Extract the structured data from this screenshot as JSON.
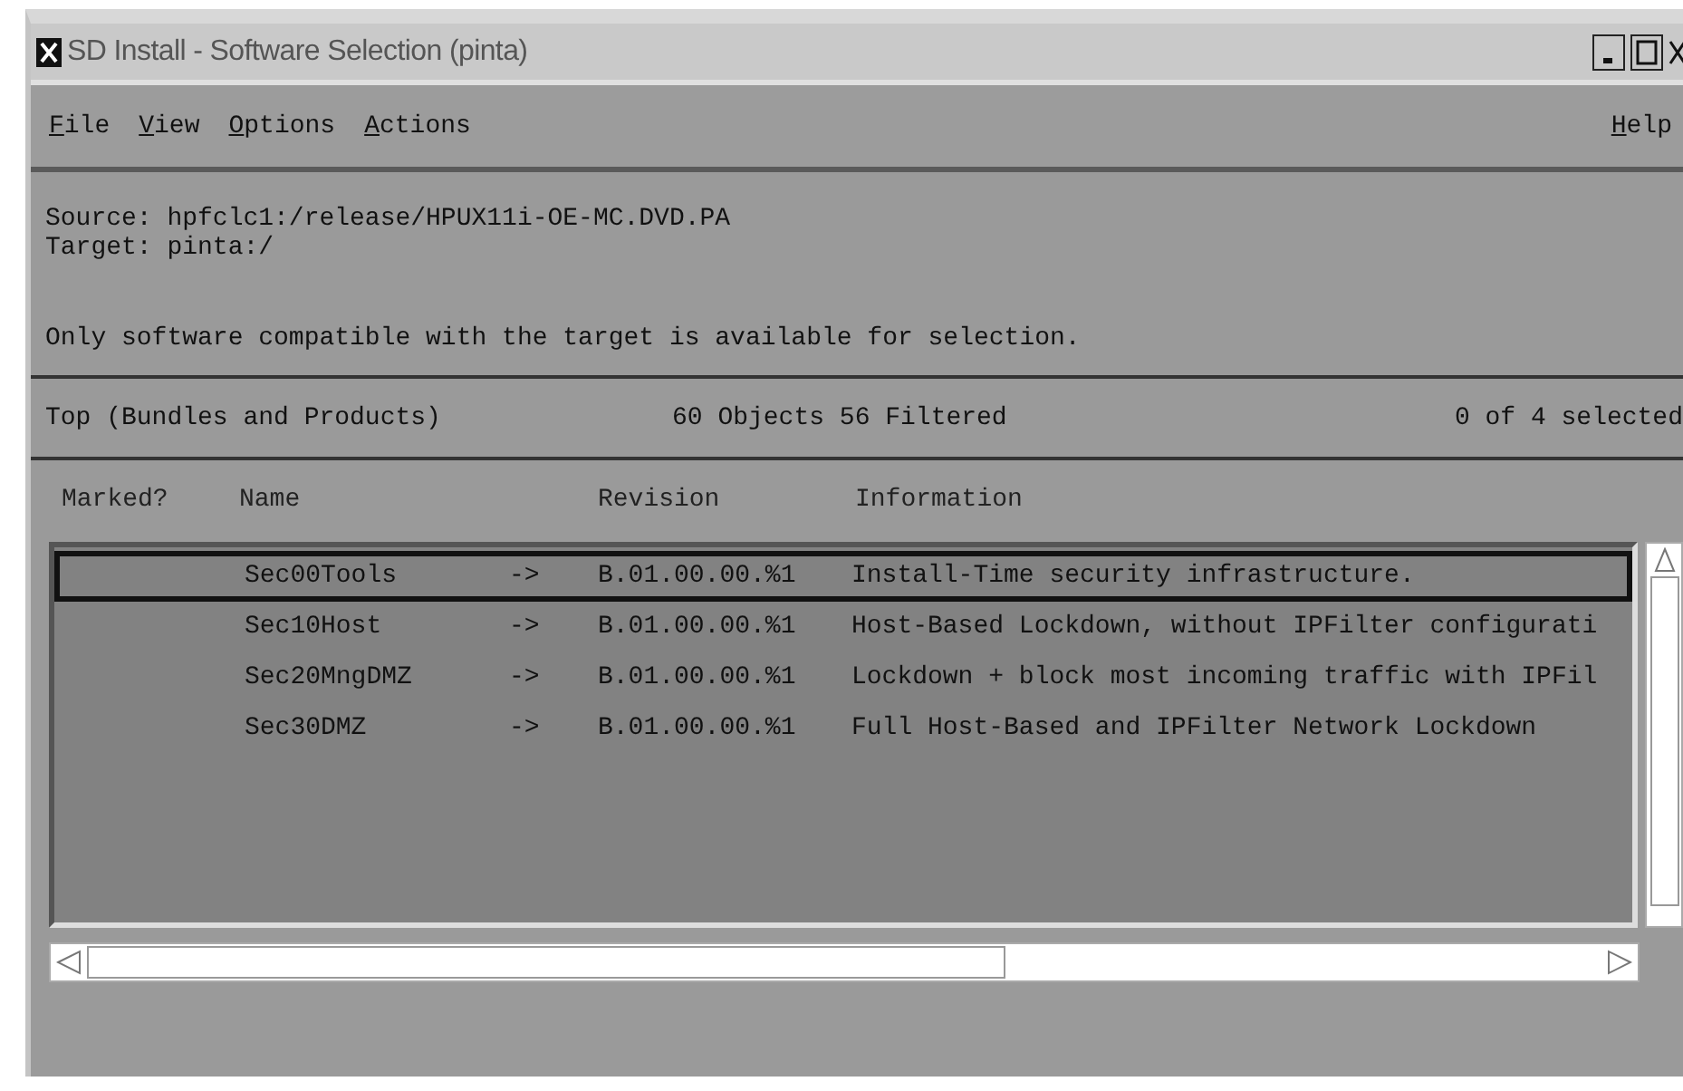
{
  "window": {
    "title": "SD Install - Software Selection (pinta)"
  },
  "menu": {
    "left": [
      "File",
      "View",
      "Options",
      "Actions"
    ],
    "right": [
      "Help"
    ]
  },
  "info": {
    "source": "Source: hpfclc1:/release/HPUX11i-OE-MC.DVD.PA",
    "target": "Target:  pinta:/",
    "note": "Only software compatible with the target is available for selection."
  },
  "summary": {
    "level": "Top (Bundles and Products)",
    "objects": "60 Objects 56 Filtered",
    "selected": "0 of 4 selected"
  },
  "table": {
    "columns": [
      "Marked?",
      "Name",
      "Revision",
      "Information"
    ],
    "rows": [
      {
        "marked": "",
        "name": "Sec00Tools",
        "arrow": "->",
        "revision": "B.01.00.00.%1",
        "information": "Install-Time security infrastructure.",
        "focused": true
      },
      {
        "marked": "",
        "name": "Sec10Host",
        "arrow": "->",
        "revision": "B.01.00.00.%1",
        "information": "Host-Based Lockdown, without IPFilter configurati",
        "focused": false
      },
      {
        "marked": "",
        "name": "Sec20MngDMZ",
        "arrow": "->",
        "revision": "B.01.00.00.%1",
        "information": "Lockdown + block most incoming traffic with IPFil",
        "focused": false
      },
      {
        "marked": "",
        "name": "Sec30DMZ",
        "arrow": "->",
        "revision": "B.01.00.00.%1",
        "information": "Full Host-Based and IPFilter Network Lockdown",
        "focused": false
      }
    ]
  }
}
